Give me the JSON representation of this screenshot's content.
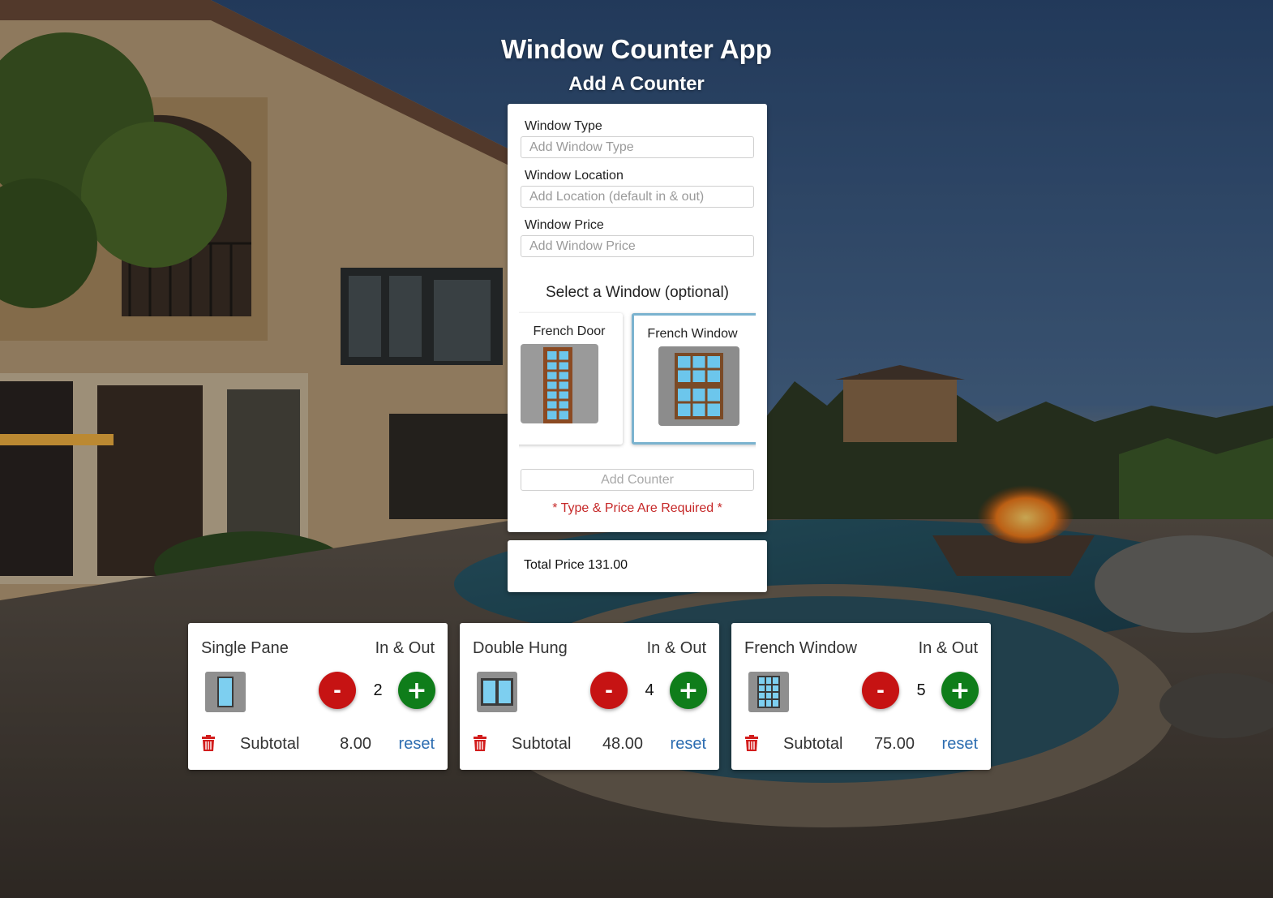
{
  "header": {
    "title": "Window Counter App",
    "subtitle": "Add A Counter"
  },
  "form": {
    "type_label": "Window Type",
    "type_placeholder": "Add Window Type",
    "location_label": "Window Location",
    "location_placeholder": "Add Location (default in & out)",
    "price_label": "Window Price",
    "price_placeholder": "Add Window Price",
    "select_title": "Select a Window (optional)",
    "window_options": [
      {
        "label": "French Door",
        "icon": "french-door-icon",
        "selected": false
      },
      {
        "label": "French Window",
        "icon": "french-window-icon",
        "selected": true
      }
    ],
    "add_button": "Add Counter",
    "required_message": "* Type & Price Are Required *"
  },
  "total": {
    "text": "Total Price 131.00"
  },
  "counters": [
    {
      "type": "Single Pane",
      "location": "In & Out",
      "icon": "single-pane-icon",
      "count": "2",
      "subtotal_label": "Subtotal",
      "subtotal": "8.00",
      "reset": "reset",
      "minus": "-",
      "plus": "+"
    },
    {
      "type": "Double Hung",
      "location": "In & Out",
      "icon": "double-hung-icon",
      "count": "4",
      "subtotal_label": "Subtotal",
      "subtotal": "48.00",
      "reset": "reset",
      "minus": "-",
      "plus": "+"
    },
    {
      "type": "French Window",
      "location": "In & Out",
      "icon": "french-window-icon",
      "count": "5",
      "subtotal_label": "Subtotal",
      "subtotal": "75.00",
      "reset": "reset",
      "minus": "-",
      "plus": "+"
    }
  ],
  "colors": {
    "minus": "#c61313",
    "plus": "#0f7d1a",
    "reset_link": "#2b6cb0",
    "required": "#c62828",
    "selected_border": "#7bb3cf"
  }
}
